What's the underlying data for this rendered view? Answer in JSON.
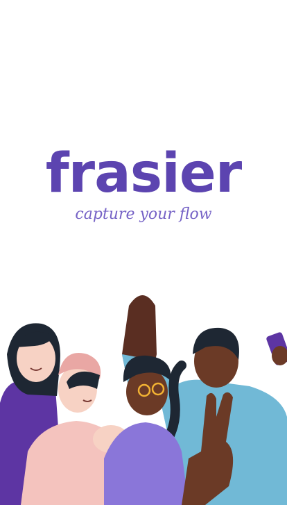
{
  "brand": {
    "name": "frasier",
    "tagline": "capture your flow",
    "color": "#5c44b0",
    "tagline_color": "#7663c6"
  },
  "illustration": {
    "subject": "group-selfie-illustration"
  }
}
